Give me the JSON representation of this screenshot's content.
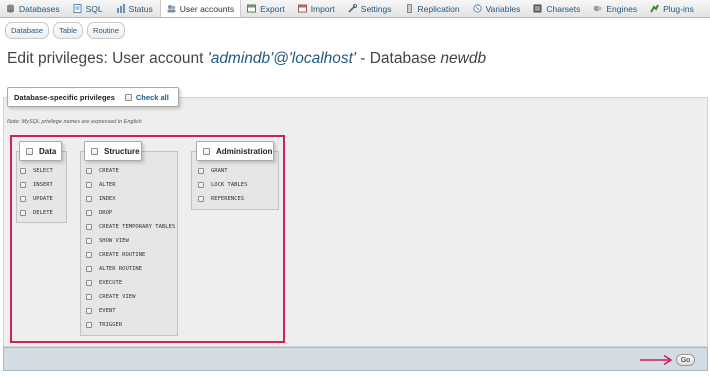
{
  "topbar": {
    "tabs": [
      {
        "label": "Databases",
        "icon": "database-icon"
      },
      {
        "label": "SQL",
        "icon": "sql-icon"
      },
      {
        "label": "Status",
        "icon": "status-icon"
      },
      {
        "label": "User accounts",
        "icon": "user-accounts-icon",
        "active": true
      },
      {
        "label": "Export",
        "icon": "export-icon"
      },
      {
        "label": "Import",
        "icon": "import-icon"
      },
      {
        "label": "Settings",
        "icon": "settings-icon"
      },
      {
        "label": "Replication",
        "icon": "replication-icon"
      },
      {
        "label": "Variables",
        "icon": "variables-icon"
      },
      {
        "label": "Charsets",
        "icon": "charsets-icon"
      },
      {
        "label": "Engines",
        "icon": "engines-icon"
      },
      {
        "label": "Plug-ins",
        "icon": "plugins-icon"
      }
    ]
  },
  "subtabs": [
    "Database",
    "Table",
    "Routine"
  ],
  "title": {
    "prefix": "Edit privileges: User account ",
    "account": "'admindb'@'localhost'",
    "middle": " - Database ",
    "database": "newdb"
  },
  "fieldset": {
    "legend": "Database-specific privileges",
    "check_all": "Check all",
    "note": "Note: MySQL privilege names are expressed in English"
  },
  "groups": {
    "data": {
      "label": "Data",
      "items": [
        "SELECT",
        "INSERT",
        "UPDATE",
        "DELETE"
      ]
    },
    "structure": {
      "label": "Structure",
      "items": [
        "CREATE",
        "ALTER",
        "INDEX",
        "DROP",
        "CREATE TEMPORARY TABLES",
        "SHOW VIEW",
        "CREATE ROUTINE",
        "ALTER ROUTINE",
        "EXECUTE",
        "CREATE VIEW",
        "EVENT",
        "TRIGGER"
      ]
    },
    "administration": {
      "label": "Administration",
      "items": [
        "GRANT",
        "LOCK TABLES",
        "REFERENCES"
      ]
    }
  },
  "footer": {
    "go_label": "Go"
  },
  "colors": {
    "accent": "#235a81",
    "highlight": "#d21f58",
    "footer_bar": "#d3dce3"
  }
}
